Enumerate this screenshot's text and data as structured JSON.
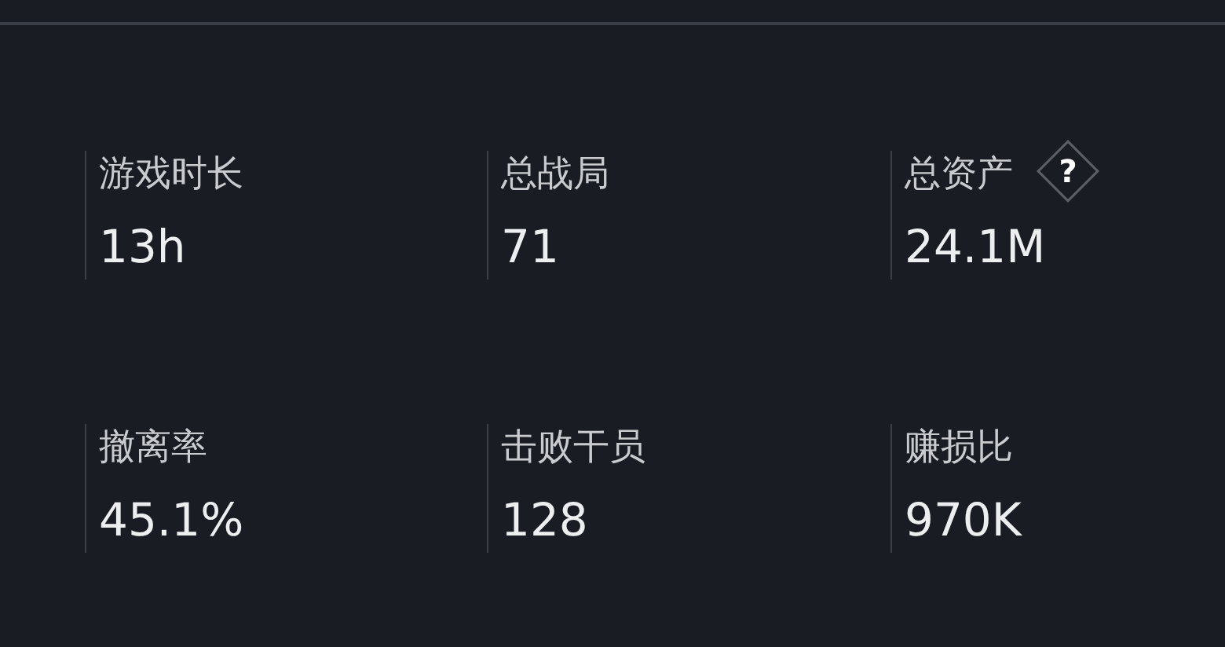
{
  "stats": [
    {
      "label": "游戏时长",
      "value": "13h"
    },
    {
      "label": "总战局",
      "value": "71"
    },
    {
      "label": "总资产",
      "value": "24.1M",
      "help": "?"
    },
    {
      "label": "撤离率",
      "value": "45.1%"
    },
    {
      "label": "击败干员",
      "value": "128"
    },
    {
      "label": "赚损比",
      "value": "970K"
    }
  ]
}
